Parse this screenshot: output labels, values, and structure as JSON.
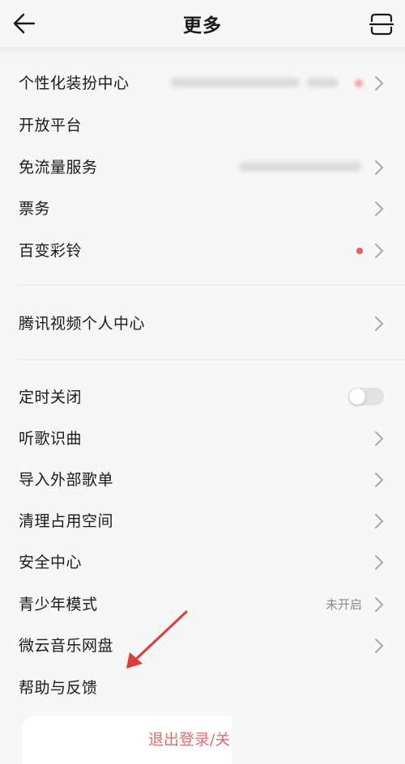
{
  "header": {
    "title": "更多"
  },
  "icons": {
    "back": "back-arrow-icon",
    "scan": "scan-icon",
    "chevron": "chevron-right-icon"
  },
  "colors": {
    "accent_red": "#ee5a5a",
    "logout_text": "#e26d6d"
  },
  "section1": [
    {
      "label": "个性化装扮中心"
    },
    {
      "label": "开放平台"
    },
    {
      "label": "免流量服务"
    },
    {
      "label": "票务"
    },
    {
      "label": "百变彩铃"
    }
  ],
  "section2": [
    {
      "label": "腾讯视频个人中心"
    }
  ],
  "section3": [
    {
      "label": "定时关闭",
      "toggle_on": false
    },
    {
      "label": "听歌识曲"
    },
    {
      "label": "导入外部歌单"
    },
    {
      "label": "清理占用空间"
    },
    {
      "label": "安全中心"
    },
    {
      "label": "青少年模式",
      "status": "未开启"
    },
    {
      "label": "微云音乐网盘"
    },
    {
      "label": "帮助与反馈"
    }
  ],
  "logout": {
    "label": "退出登录/关"
  }
}
